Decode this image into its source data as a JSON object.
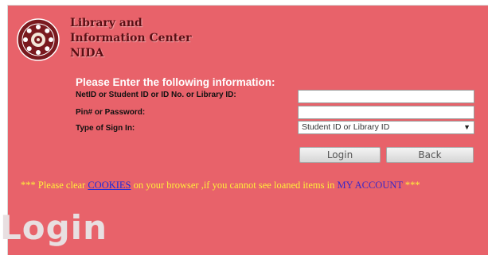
{
  "brand": {
    "line1": "Library and",
    "line2": "Information Center",
    "line3": "NIDA"
  },
  "form": {
    "prompt": "Please Enter the following information:",
    "id_label": "NetID or Student ID or ID No. or Library ID:",
    "id_value": "",
    "pin_label": "Pin# or Password:",
    "pin_value": "",
    "type_label": "Type of Sign In:",
    "type_selected": "Student ID or Library ID",
    "login_button": "Login",
    "back_button": "Back"
  },
  "notice": {
    "prefix": "*** Please clear",
    "cookies_link": "COOKIES",
    "middle": "on your browser ,if you cannot see loaned items in",
    "account_link": "MY ACCOUNT",
    "suffix": "***"
  },
  "page_heading": "Login",
  "colors": {
    "panel": "#e8626a",
    "prompt": "#ffffff",
    "notice": "#ffef3a",
    "link": "#1e2bd9"
  },
  "icons": {
    "seal": "nida-seal-logo",
    "dropdown": "chevron-down-icon"
  }
}
